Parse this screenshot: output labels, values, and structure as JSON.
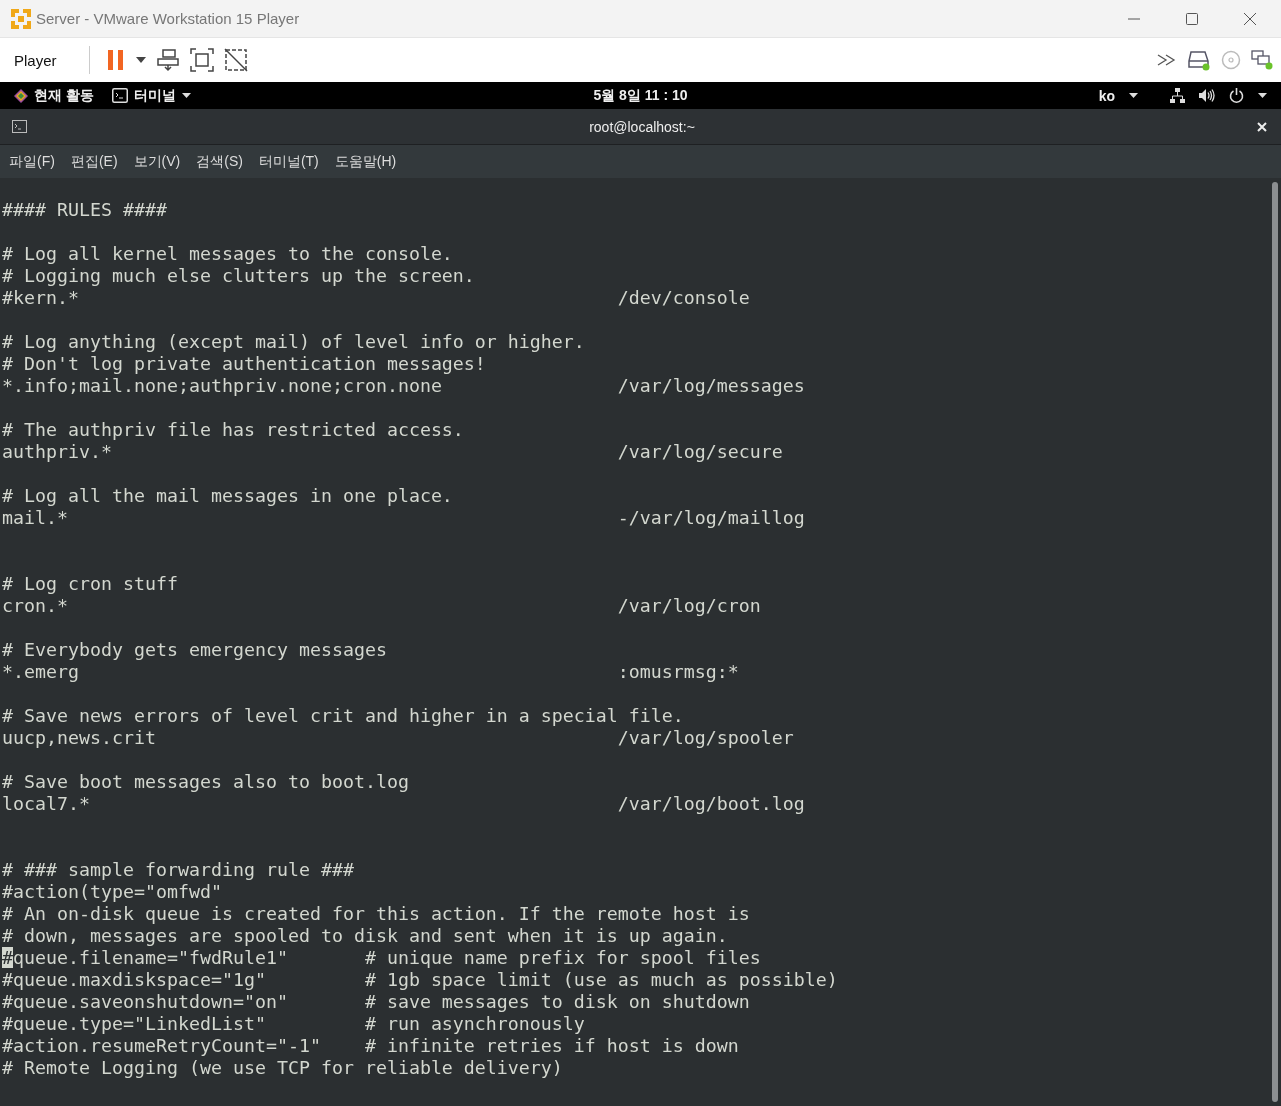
{
  "window": {
    "title": "Server - VMware Workstation 15 Player"
  },
  "toolbar": {
    "menu": "Player"
  },
  "top_bar": {
    "activities": "현재 활동",
    "app_menu": "터미널",
    "clock": "5월 8일  11 : 10",
    "input_method": "ko"
  },
  "terminal": {
    "title": "root@localhost:~",
    "menu": [
      "파일(F)",
      "편집(E)",
      "보기(V)",
      "검색(S)",
      "터미널(T)",
      "도움말(H)"
    ],
    "lines": [
      {
        "kind": "text",
        "text": "#### RULES ####"
      },
      {
        "kind": "blank"
      },
      {
        "kind": "text",
        "text": "# Log all kernel messages to the console."
      },
      {
        "kind": "text",
        "text": "# Logging much else clutters up the screen."
      },
      {
        "kind": "text",
        "text": "#kern.*                                                 /dev/console"
      },
      {
        "kind": "blank"
      },
      {
        "kind": "text",
        "text": "# Log anything (except mail) of level info or higher."
      },
      {
        "kind": "text",
        "text": "# Don't log private authentication messages!"
      },
      {
        "kind": "text",
        "text": "*.info;mail.none;authpriv.none;cron.none                /var/log/messages"
      },
      {
        "kind": "blank"
      },
      {
        "kind": "text",
        "text": "# The authpriv file has restricted access."
      },
      {
        "kind": "text",
        "text": "authpriv.*                                              /var/log/secure"
      },
      {
        "kind": "blank"
      },
      {
        "kind": "text",
        "text": "# Log all the mail messages in one place."
      },
      {
        "kind": "text",
        "text": "mail.*                                                  -/var/log/maillog"
      },
      {
        "kind": "blank"
      },
      {
        "kind": "blank"
      },
      {
        "kind": "text",
        "text": "# Log cron stuff"
      },
      {
        "kind": "text",
        "text": "cron.*                                                  /var/log/cron"
      },
      {
        "kind": "blank"
      },
      {
        "kind": "text",
        "text": "# Everybody gets emergency messages"
      },
      {
        "kind": "text",
        "text": "*.emerg                                                 :omusrmsg:*"
      },
      {
        "kind": "blank"
      },
      {
        "kind": "text",
        "text": "# Save news errors of level crit and higher in a special file."
      },
      {
        "kind": "text",
        "text": "uucp,news.crit                                          /var/log/spooler"
      },
      {
        "kind": "blank"
      },
      {
        "kind": "text",
        "text": "# Save boot messages also to boot.log"
      },
      {
        "kind": "text",
        "text": "local7.*                                                /var/log/boot.log"
      },
      {
        "kind": "blank"
      },
      {
        "kind": "blank"
      },
      {
        "kind": "text",
        "text": "# ### sample forwarding rule ###"
      },
      {
        "kind": "text",
        "text": "#action(type=\"omfwd\""
      },
      {
        "kind": "text",
        "text": "# An on-disk queue is created for this action. If the remote host is"
      },
      {
        "kind": "text",
        "text": "# down, messages are spooled to disk and sent when it is up again."
      },
      {
        "kind": "text",
        "text": "#queue.filename=\"fwdRule1\"       # unique name prefix for spool files",
        "cursor": true
      },
      {
        "kind": "text",
        "text": "#queue.maxdiskspace=\"1g\"         # 1gb space limit (use as much as possible)"
      },
      {
        "kind": "text",
        "text": "#queue.saveonshutdown=\"on\"       # save messages to disk on shutdown"
      },
      {
        "kind": "text",
        "text": "#queue.type=\"LinkedList\"         # run asynchronously"
      },
      {
        "kind": "text",
        "text": "#action.resumeRetryCount=\"-1\"    # infinite retries if host is down"
      },
      {
        "kind": "text",
        "text": "# Remote Logging (we use TCP for reliable delivery)"
      }
    ]
  }
}
